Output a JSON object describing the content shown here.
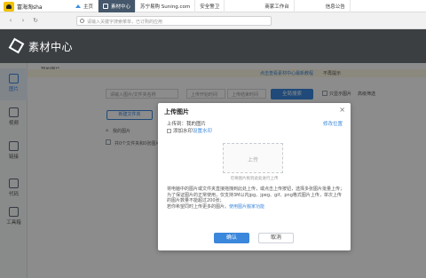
{
  "topbar": {
    "shop_name": "富海淘sha",
    "tabs": [
      {
        "label": "主页"
      },
      {
        "label": "素材中心"
      },
      {
        "label": "苏宁易购 Suning.com"
      },
      {
        "label": "安全警卫"
      },
      {
        "label": "商家工作台"
      },
      {
        "label": "信息公告"
      }
    ]
  },
  "addressbar": {
    "placeholder": "请输入关键字搜索菜单，已订购的应用"
  },
  "app": {
    "logo_text": "素材中心"
  },
  "leftnav": {
    "items": [
      {
        "label": "图片",
        "icon": "image-icon"
      },
      {
        "label": "视频",
        "icon": "video-icon"
      },
      {
        "label": "链接",
        "icon": "link-icon"
      },
      {
        "label": "代码",
        "icon": "code-icon"
      },
      {
        "label": "工具箱",
        "icon": "toolbox-icon"
      }
    ]
  },
  "main": {
    "breadcrumb": "我的图片",
    "notice_link": "点击查看素材中心最新教程",
    "notice_dismiss": "不再提示",
    "filter": {
      "name_placeholder": "请输入图片/文件夹名称",
      "start_time": "上传开始时间",
      "end_time": "上传结束时间",
      "search_button": "全局搜索",
      "only_show_images": "只显示图片",
      "advanced_filter": "高级筛选"
    },
    "new_folder_button": "新建文件夹",
    "grid_breadcrumb": "我的图片",
    "summary": "共0个文件夹和0张图片"
  },
  "modal": {
    "title": "上传图片",
    "upload_to_label": "上传到：我的图片",
    "modify_location": "修改位置",
    "add_watermark": "添加水印",
    "set_watermark": "设置水印",
    "dropzone_label": "上传",
    "dropzone_hint": "可将图片拖到此处进行上传",
    "tips": [
      "将电脑中的图片或文件夹直接拖拽到此处上传，或点击上传按钮，选择多张图片批量上传；",
      "为了保证图片的正常使用，仅支持3M以内jpg、jpeg、gif、png格式图片上传，单次上传的图片数量不能超过200张；",
      "若你希望同时上传更多的图片。"
    ],
    "tips_link": "使用图片搬家功能",
    "ok_button": "确认",
    "cancel_button": "取消"
  }
}
